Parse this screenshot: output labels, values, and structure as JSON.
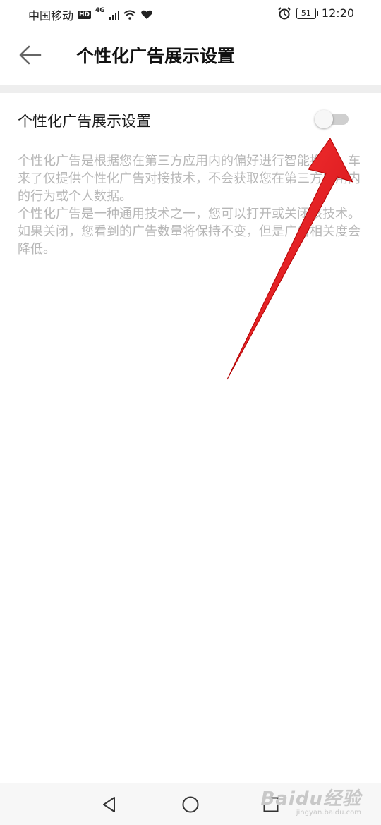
{
  "status_bar": {
    "carrier": "中国移动",
    "hd_badge": "HD",
    "network": "4G",
    "battery": "51",
    "time": "12:20",
    "icons": [
      "signal-icon",
      "wifi-icon",
      "heart-icon",
      "alarm-icon",
      "battery-icon"
    ]
  },
  "header": {
    "title": "个性化广告展示设置",
    "back_icon": "arrow-left-icon"
  },
  "setting": {
    "label": "个性化广告展示设置",
    "enabled": false
  },
  "description": {
    "paragraph_1": "个性化广告是根据您在第三方应用内的偏好进行智能推荐。车来了仅提供个性化广告对接技术，不会获取您在第三方应用内的行为或个人数据。",
    "paragraph_2": "个性化广告是一种通用技术之一，您可以打开或关闭该技术。如果关闭，您看到的广告数量将保持不变，但是广告相关度会降低。"
  },
  "colors": {
    "annotation_arrow": "#e8141c",
    "toggle_off_track": "#cfcfcf",
    "description_text": "#b7b7b7"
  },
  "nav": {
    "icons": [
      "back-triangle-icon",
      "home-circle-icon",
      "recents-square-icon"
    ]
  },
  "watermark": {
    "logo": "Baidu经验",
    "url": "jingyan.baidu.com"
  }
}
